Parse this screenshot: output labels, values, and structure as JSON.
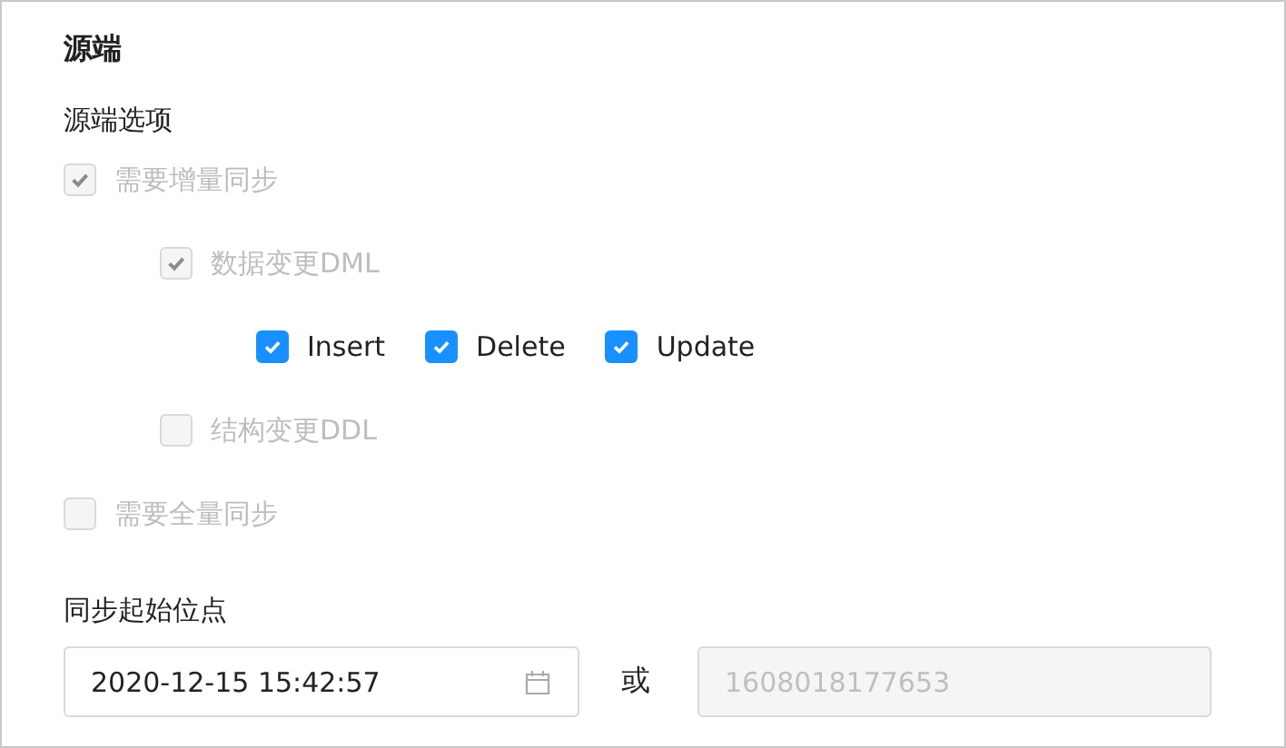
{
  "section_title": "源端",
  "options_label": "源端选项",
  "options": [
    {
      "label": "需要增量同步",
      "checked": true,
      "disabled": true,
      "children": [
        {
          "label": "数据变更DML",
          "checked": true,
          "disabled": true,
          "inline_options": [
            {
              "label": "Insert",
              "checked": true,
              "disabled": false
            },
            {
              "label": "Delete",
              "checked": true,
              "disabled": false
            },
            {
              "label": "Update",
              "checked": true,
              "disabled": false
            }
          ]
        },
        {
          "label": "结构变更DDL",
          "checked": false,
          "disabled": true
        }
      ]
    },
    {
      "label": "需要全量同步",
      "checked": false,
      "disabled": true
    }
  ],
  "start_point": {
    "label": "同步起始位点",
    "datetime": {
      "value": "2020-12-15 15:42:57"
    },
    "separator": "或",
    "timestamp": {
      "value": "1608018177653",
      "disabled": true
    }
  }
}
